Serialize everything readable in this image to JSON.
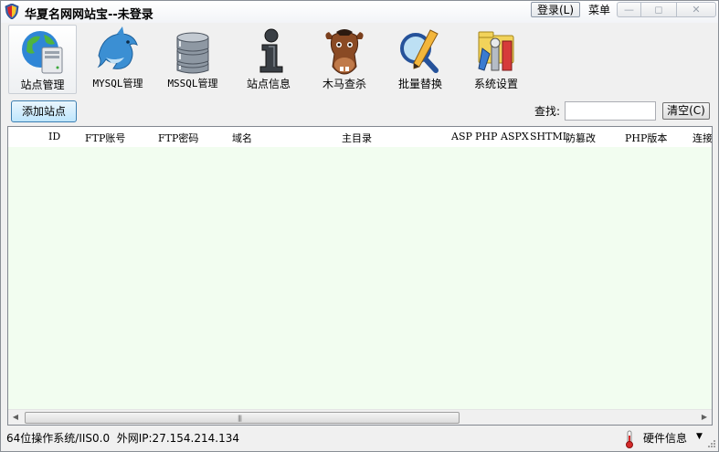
{
  "window": {
    "title": "华夏名网网站宝--未登录"
  },
  "titlebar": {
    "login_label": "登录(L)",
    "menu_label": "菜单"
  },
  "toolbar": {
    "items": [
      {
        "label": "站点管理",
        "icon": "globe-server-icon"
      },
      {
        "label": "MYSQL管理",
        "icon": "dolphin-icon"
      },
      {
        "label": "MSSQL管理",
        "icon": "database-icon"
      },
      {
        "label": "站点信息",
        "icon": "info-icon"
      },
      {
        "label": "木马查杀",
        "icon": "horse-icon"
      },
      {
        "label": "批量替换",
        "icon": "magnifier-pencil-icon"
      },
      {
        "label": "系统设置",
        "icon": "tools-icon"
      }
    ]
  },
  "actions": {
    "add_site": "添加站点",
    "search_label": "查找:",
    "search_value": "",
    "clear_label": "清空(C)"
  },
  "table": {
    "columns": [
      "ID",
      "FTP账号",
      "FTP密码",
      "域名",
      "主目录",
      "ASP",
      "PHP",
      "ASPX",
      "SHTML",
      "防篡改",
      "PHP版本",
      "连接"
    ],
    "rows": []
  },
  "status": {
    "system": "64位操作系统/IIS0.0",
    "ip": "外网IP:27.154.214.134",
    "hardware_label": "硬件信息"
  },
  "colors": {
    "grid_background": "#f2fdf0",
    "accent_button": "#bee6fd"
  }
}
